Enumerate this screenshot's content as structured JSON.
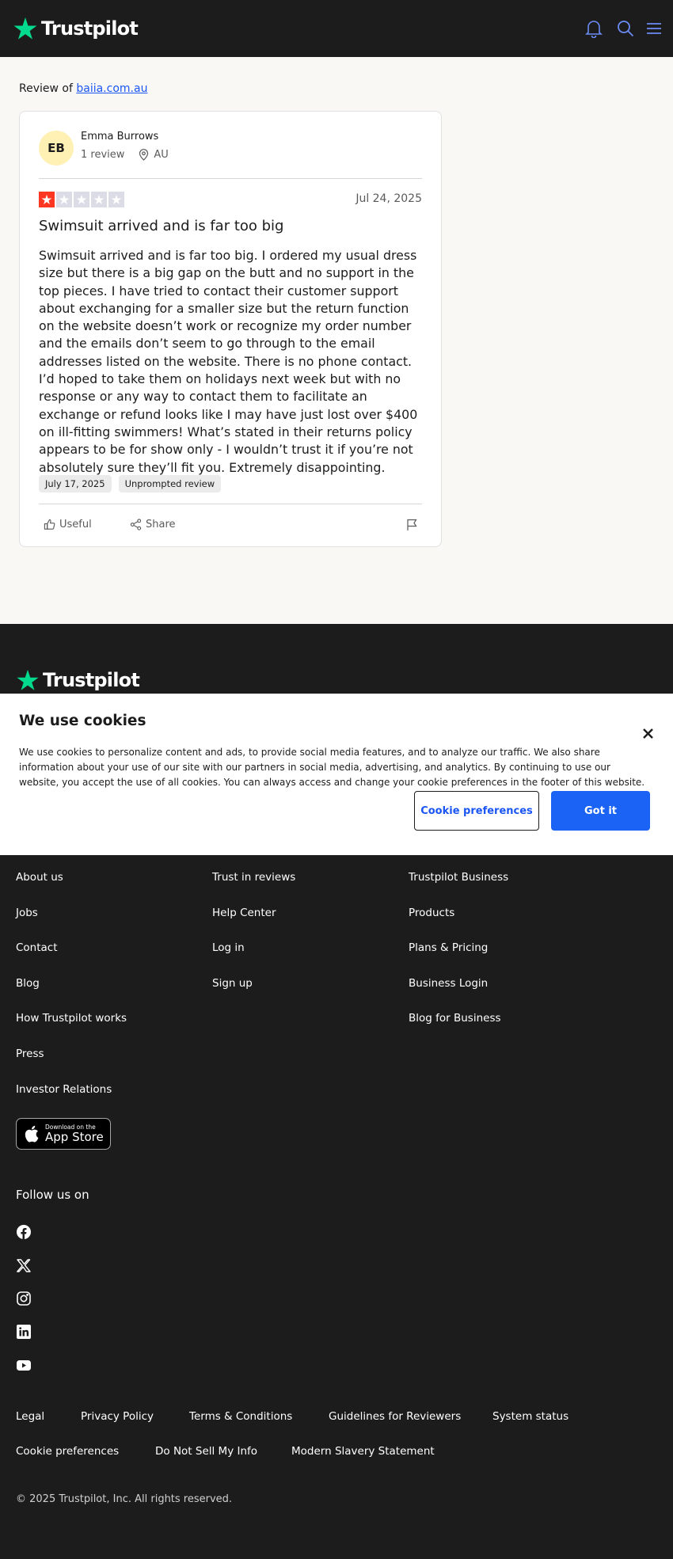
{
  "header": {
    "brand": "Trustpilot",
    "icons": [
      "bell-icon",
      "search-icon",
      "menu-icon"
    ],
    "icon_color": "#6c8cf5"
  },
  "main": {
    "review_of_label": "Review of",
    "company_link": "baiia.com.au",
    "review": {
      "avatar_initials": "EB",
      "reviewer_name": "Emma Burrows",
      "review_count": "1 review",
      "country": "AU",
      "rating": 1,
      "rating_max": 5,
      "date": "Jul 24, 2025",
      "title": "Swimsuit arrived and is far too big",
      "body": "Swimsuit arrived and is far too big. I ordered my usual dress size but there is a big gap on the butt and no support in the top pieces. I have tried to contact their customer support about exchanging for a smaller size but the return function on the website doesn’t work or recognize my order number and the emails don’t seem to go through to the email addresses listed on the website. There is no phone contact. I’d hoped to take them on holidays next week but with no response or any way to contact them to facilitate an exchange or refund looks like I may have just lost over $400 on ill-fitting swimmers! What’s stated in their returns policy appears to be for show only - I wouldn’t trust it if you’re not absolutely sure they’ll fit you. Extremely disappointing.",
      "experience_date": "July 17, 2025",
      "tag": "Unprompted review",
      "useful_label": "Useful",
      "share_label": "Share"
    },
    "colors": {
      "star_red": "#ff3722",
      "star_empty": "#dcdce6",
      "link": "#1b56f4"
    }
  },
  "cookie_banner": {
    "title": "We use cookies",
    "text": "We use cookies to personalize content and ads, to provide social media features, and to analyze our traffic. We also share information about your use of our site with our partners in social media, advertising, and analytics. By continuing to use our website, you accept the use of all cookies. You can always access and change your cookie preferences in the footer of this website.",
    "preferences_button": "Cookie preferences",
    "accept_button": "Got it"
  },
  "footer": {
    "brand": "Trustpilot",
    "col1": [
      "About us",
      "Jobs",
      "Contact",
      "Blog",
      "How Trustpilot works",
      "Press",
      "Investor Relations"
    ],
    "col2": [
      "Trust in reviews",
      "Help Center",
      "Log in",
      "Sign up"
    ],
    "col3": [
      "Trustpilot Business",
      "Products",
      "Plans & Pricing",
      "Business Login",
      "Blog for Business"
    ],
    "app_store_small": "Download on the",
    "app_store_big": "App Store",
    "follow_label": "Follow us on",
    "social_icons": [
      "facebook-icon",
      "x-icon",
      "instagram-icon",
      "linkedin-icon",
      "youtube-icon"
    ],
    "legal_row1": [
      "Legal",
      "Privacy Policy",
      "Terms & Conditions",
      "Guidelines for Reviewers",
      "System status"
    ],
    "legal_row2": [
      "Cookie preferences",
      "Do Not Sell My Info",
      "Modern Slavery Statement"
    ],
    "copyright": "© 2025 Trustpilot, Inc. All rights reserved.",
    "brand_green": "#04da8d"
  }
}
